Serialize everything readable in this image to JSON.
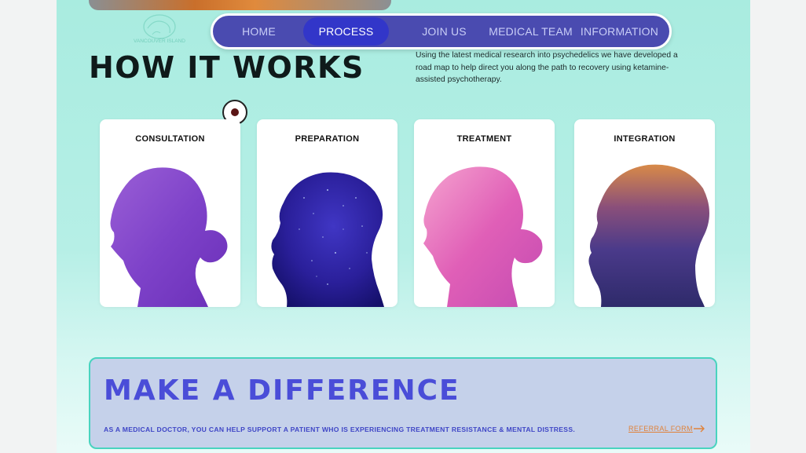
{
  "nav": {
    "items": [
      {
        "label": "HOME"
      },
      {
        "label": "PROCESS",
        "active": true
      },
      {
        "label": "JOIN US"
      },
      {
        "label": "MEDICAL TEAM"
      },
      {
        "label": "INFORMATION"
      }
    ]
  },
  "logo": {
    "text": "VANCOUVER ISLAND"
  },
  "hero": {
    "title": "HOW IT WORKS",
    "intro": "Using the latest medical research into psychedelics we have developed a road map to help direct you along the path to recovery using ketamine-assisted psychotherapy."
  },
  "steps": [
    {
      "title": "CONSULTATION",
      "image": "purple-woman-silhouette"
    },
    {
      "title": "PREPARATION",
      "image": "galaxy-man-silhouette"
    },
    {
      "title": "TREATMENT",
      "image": "pink-woman-silhouette"
    },
    {
      "title": "INTEGRATION",
      "image": "sunset-man-silhouette"
    }
  ],
  "banner": {
    "title": "MAKE A DIFFERENCE",
    "text": "AS A MEDICAL DOCTOR, YOU CAN HELP SUPPORT A PATIENT WHO IS EXPERIENCING TREATMENT RESISTANCE & MENTAL DISTRESS.",
    "link": "REFERRAL FORM"
  },
  "colors": {
    "nav_bg": "#4a4bb0",
    "nav_active": "#3236c9",
    "page_bg": "#b6efe6",
    "banner_bg": "#c5d1ea",
    "banner_accent": "#4a4dd8",
    "link": "#e0823a"
  }
}
